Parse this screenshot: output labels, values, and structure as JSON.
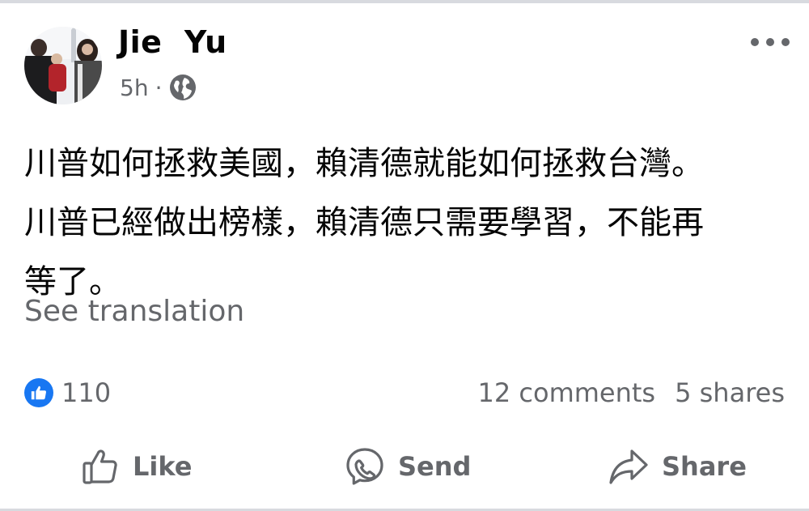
{
  "post": {
    "author": "Jie  Yu",
    "time": "5h",
    "separator": "·",
    "text_lines": [
      "川普如何拯救美國，賴清德就能如何拯救台灣。",
      "川普已經做出榜樣，賴清德只需要學習，不能再",
      "等了。"
    ],
    "see_translation": "See translation"
  },
  "engagement": {
    "reaction_count": "110",
    "comments": "12 comments",
    "shares": "5 shares"
  },
  "actions": {
    "like": "Like",
    "send": "Send",
    "share": "Share"
  },
  "icons": {
    "audience": "globe-icon",
    "more": "more-options-icon",
    "reaction": "thumbs-up-icon",
    "like": "thumbs-up-outline-icon",
    "send": "messenger-icon",
    "share": "share-arrow-icon"
  },
  "colors": {
    "text": "#050505",
    "secondary": "#65676b",
    "accent": "#1877f2"
  }
}
